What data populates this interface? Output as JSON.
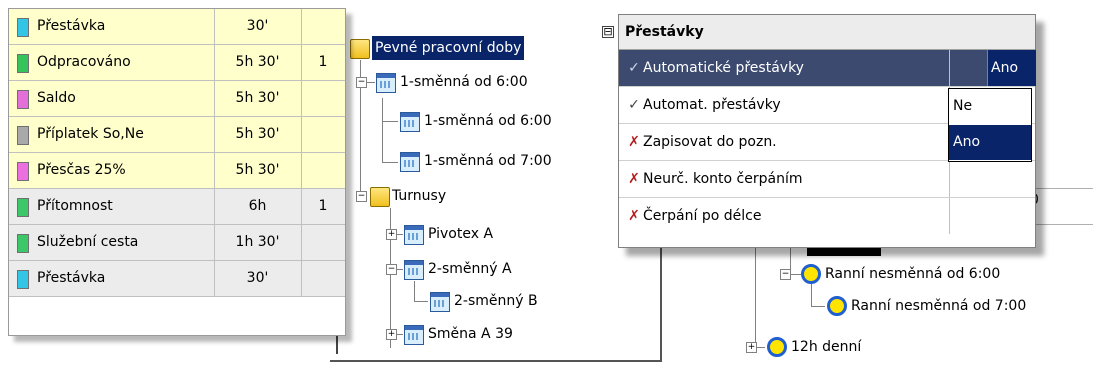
{
  "time_table": {
    "rows": [
      {
        "name": "Přestávka",
        "value": "30'",
        "count": "",
        "swatch": "#33c5e6",
        "band": "yellow"
      },
      {
        "name": "Odpracováno",
        "value": "5h 30'",
        "count": "1",
        "swatch": "#35c35b",
        "band": "yellow"
      },
      {
        "name": "Saldo",
        "value": "5h 30'",
        "count": "",
        "swatch": "#e36fd9",
        "band": "yellow"
      },
      {
        "name": "Příplatek So,Ne",
        "value": "5h 30'",
        "count": "",
        "swatch": "#a9a9a9",
        "band": "yellow"
      },
      {
        "name": "Přesčas 25%",
        "value": "5h 30'",
        "count": "",
        "swatch": "#ec6fe0",
        "band": "yellow"
      },
      {
        "name": "Přítomnost",
        "value": "6h",
        "count": "1",
        "swatch": "#3cc868",
        "band": "gray"
      },
      {
        "name": "Služební cesta",
        "value": "1h 30'",
        "count": "",
        "swatch": "#3cc868",
        "band": "gray"
      },
      {
        "name": "Přestávka",
        "value": "30'",
        "count": "",
        "swatch": "#33c5e6",
        "band": "gray"
      }
    ]
  },
  "tree": {
    "root": "Pevné pracovní doby",
    "n1": "1-směnná od 6:00",
    "n1a": "1-směnná od 6:00",
    "n1b": "1-směnná od 7:00",
    "turnusy": "Turnusy",
    "pivotex": "Pivotex A",
    "dvasmenny_a": "2-směnný A",
    "dvasmenny_b": "2-směnný B",
    "smena_a39": "Směna A 39"
  },
  "shift_tree": {
    "ranni_6": "Ranní nesměnná od 6:00",
    "ranni_7": "Ranní nesměnná od 7:00",
    "denni_12h": "12h denní",
    "stray_char": "0"
  },
  "popup": {
    "title": "Přestávky",
    "collapse_glyph": "⊟",
    "rows": [
      {
        "label": "Automatické přestávky",
        "value": "Ano",
        "mark": "✓",
        "mark_type": "check"
      },
      {
        "label": "Automat. přestávky",
        "value": "",
        "mark": "✓",
        "mark_type": "check"
      },
      {
        "label": "Zapisovat do pozn.",
        "value": "",
        "mark": "✗",
        "mark_type": "cross"
      },
      {
        "label": "Neurč. konto čerpáním",
        "value": "",
        "mark": "✗",
        "mark_type": "cross"
      },
      {
        "label": "Čerpání po délce",
        "value": "",
        "mark": "✗",
        "mark_type": "cross"
      }
    ],
    "dropdown_options": [
      "Ne",
      "Ano"
    ],
    "dropdown_selected": "Ano"
  },
  "colors": {
    "selection": "#0a246a",
    "row_highlight": "#3b4a6e",
    "yellow_band": "#ffffcc"
  }
}
